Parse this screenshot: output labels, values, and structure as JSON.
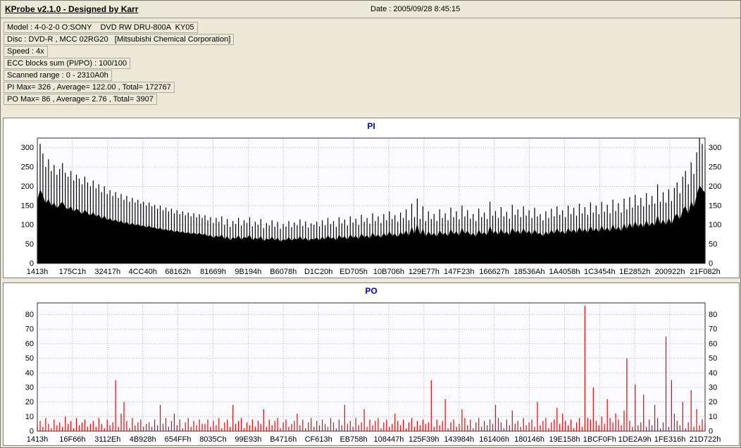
{
  "header": {
    "title": "KProbe v2.1.0 - Designed by Karr",
    "date_label": "Date : 2005/09/28 8:45:15"
  },
  "info": {
    "lines": [
      "Model : 4-0-2-0 O:SONY    DVD RW DRU-800A  KY05",
      "Disc : DVD-R , MCC 02RG20   [Mitsubishi Chemical Corporation]",
      "Speed : 4x",
      "ECC blocks sum (PI/PO) : 100/100",
      "Scanned range : 0 - 2310A0h",
      "PI Max= 326 , Average= 122.00 , Total= 172767",
      "PO Max= 86 , Average= 2.76 , Total= 3907"
    ]
  },
  "colors": {
    "window_bg": "#ECE9D8",
    "pi_series": "#000000",
    "po_series": "#E80000",
    "chart_title": "#0000C8",
    "plot_bg": "#FBFBFF"
  },
  "chart_data": [
    {
      "type": "bar",
      "title": "PI",
      "series_style": "dense",
      "color": "#000000",
      "plot_bg": "#FBFBFF",
      "ylim": [
        0,
        325
      ],
      "yticks": [
        0,
        50,
        100,
        150,
        200,
        250,
        300
      ],
      "grid": "dotted",
      "xticklabels": [
        "1413h",
        "175C1h",
        "32417h",
        "4CC40h",
        "68162h",
        "81669h",
        "9B194h",
        "B6078h",
        "D1C20h",
        "ED705h",
        "10B706h",
        "129E77h",
        "147F23h",
        "166627h",
        "18536Ah",
        "1A4058h",
        "1C3454h",
        "1E2852h",
        "200922h",
        "21F082h"
      ],
      "stats": {
        "max": 326,
        "average": 122.0,
        "total": 172767
      },
      "values": [
        265,
        310,
        285,
        250,
        270,
        240,
        255,
        230,
        245,
        260,
        235,
        225,
        240,
        215,
        230,
        220,
        205,
        225,
        210,
        200,
        215,
        195,
        205,
        185,
        200,
        180,
        190,
        175,
        185,
        170,
        180,
        165,
        175,
        160,
        170,
        158,
        165,
        155,
        160,
        150,
        158,
        148,
        152,
        142,
        150,
        138,
        145,
        135,
        142,
        130,
        138,
        128,
        135,
        125,
        132,
        122,
        130,
        120,
        128,
        118,
        125,
        112,
        120,
        105,
        118,
        108,
        122,
        100,
        115,
        95,
        110,
        102,
        118,
        98,
        112,
        105,
        120,
        96,
        108,
        100,
        115,
        92,
        105,
        98,
        112,
        95,
        108,
        90,
        102,
        96,
        110,
        94,
        106,
        99,
        114,
        97,
        109,
        93,
        104,
        100,
        108,
        96,
        112,
        99,
        118,
        102,
        110,
        95,
        120,
        104,
        114,
        98,
        122,
        106,
        116,
        100,
        126,
        108,
        118,
        103,
        130,
        110,
        122,
        105,
        128,
        112,
        135,
        115,
        125,
        108,
        132,
        118,
        140,
        112,
        155,
        120,
        168,
        115,
        148,
        110,
        135,
        115,
        128,
        110,
        140,
        118,
        130,
        112,
        145,
        120,
        135,
        114,
        150,
        122,
        138,
        116,
        128,
        110,
        142,
        120,
        132,
        115,
        160,
        124,
        136,
        118,
        146,
        122,
        134,
        116,
        152,
        126,
        140,
        120,
        148,
        124,
        138,
        118,
        144,
        122,
        128,
        112,
        135,
        118,
        142,
        122,
        148,
        126,
        138,
        120,
        150,
        128,
        144,
        124,
        155,
        130,
        146,
        126,
        158,
        132,
        150,
        128,
        160,
        134,
        152,
        130,
        165,
        136,
        156,
        132,
        168,
        140,
        172,
        145,
        178,
        150,
        170,
        148,
        182,
        152,
        175,
        155,
        205,
        160,
        185,
        158,
        192,
        162,
        196,
        210,
        182,
        225,
        240,
        205,
        262,
        232,
        288,
        326,
        310,
        295
      ]
    },
    {
      "type": "bar",
      "title": "PO",
      "series_style": "sparse",
      "color": "#E80000",
      "plot_bg": "#FBFBFF",
      "ylim": [
        0,
        88
      ],
      "yticks": [
        0,
        10,
        20,
        30,
        40,
        50,
        60,
        70,
        80
      ],
      "grid": "dotted",
      "xticklabels": [
        "1413h",
        "16F66h",
        "3112Eh",
        "4B928h",
        "654FFh",
        "8035Ch",
        "99E93h",
        "B4716h",
        "CF613h",
        "EB758h",
        "108447h",
        "125F39h",
        "143984h",
        "161406h",
        "180146h",
        "19E158h",
        "1BCF0Fh",
        "1DE2A9h",
        "1FE316h",
        "21D722h"
      ],
      "stats": {
        "max": 86,
        "average": 2.76,
        "total": 3907
      },
      "values": [
        4,
        7,
        3,
        9,
        5,
        2,
        8,
        4,
        6,
        3,
        10,
        5,
        7,
        2,
        9,
        4,
        6,
        8,
        3,
        5,
        7,
        3,
        9,
        5,
        2,
        8,
        4,
        6,
        35,
        3,
        12,
        20,
        7,
        2,
        9,
        4,
        6,
        8,
        3,
        5,
        6,
        3,
        8,
        4,
        18,
        5,
        9,
        3,
        7,
        12,
        4,
        8,
        2,
        6,
        9,
        3,
        7,
        4,
        8,
        5,
        5,
        8,
        3,
        7,
        4,
        9,
        2,
        6,
        8,
        3,
        18,
        5,
        7,
        9,
        2,
        6,
        4,
        8,
        3,
        7,
        5,
        15,
        3,
        8,
        4,
        7,
        9,
        2,
        6,
        8,
        3,
        5,
        7,
        12,
        4,
        8,
        2,
        6,
        9,
        3,
        7,
        4,
        8,
        5,
        3,
        9,
        6,
        2,
        8,
        4,
        18,
        5,
        7,
        3,
        9,
        4,
        6,
        15,
        3,
        8,
        4,
        7,
        9,
        2,
        6,
        8,
        3,
        5,
        12,
        7,
        4,
        8,
        2,
        6,
        9,
        3,
        7,
        4,
        8,
        5,
        6,
        35,
        3,
        8,
        4,
        7,
        22,
        2,
        6,
        8,
        3,
        5,
        15,
        9,
        4,
        8,
        2,
        6,
        9,
        3,
        7,
        4,
        8,
        5,
        18,
        9,
        6,
        2,
        8,
        4,
        14,
        5,
        7,
        3,
        9,
        4,
        6,
        8,
        3,
        20,
        4,
        7,
        9,
        2,
        6,
        8,
        16,
        5,
        12,
        7,
        4,
        8,
        2,
        6,
        9,
        3,
        86,
        9,
        8,
        30,
        7,
        4,
        10,
        5,
        22,
        9,
        6,
        12,
        8,
        4,
        14,
        50,
        7,
        3,
        32,
        4,
        6,
        25,
        3,
        8,
        4,
        18,
        9,
        2,
        6,
        65,
        3,
        35,
        12,
        7,
        4,
        20,
        2,
        6,
        28,
        3,
        15,
        4,
        8,
        5
      ]
    }
  ]
}
